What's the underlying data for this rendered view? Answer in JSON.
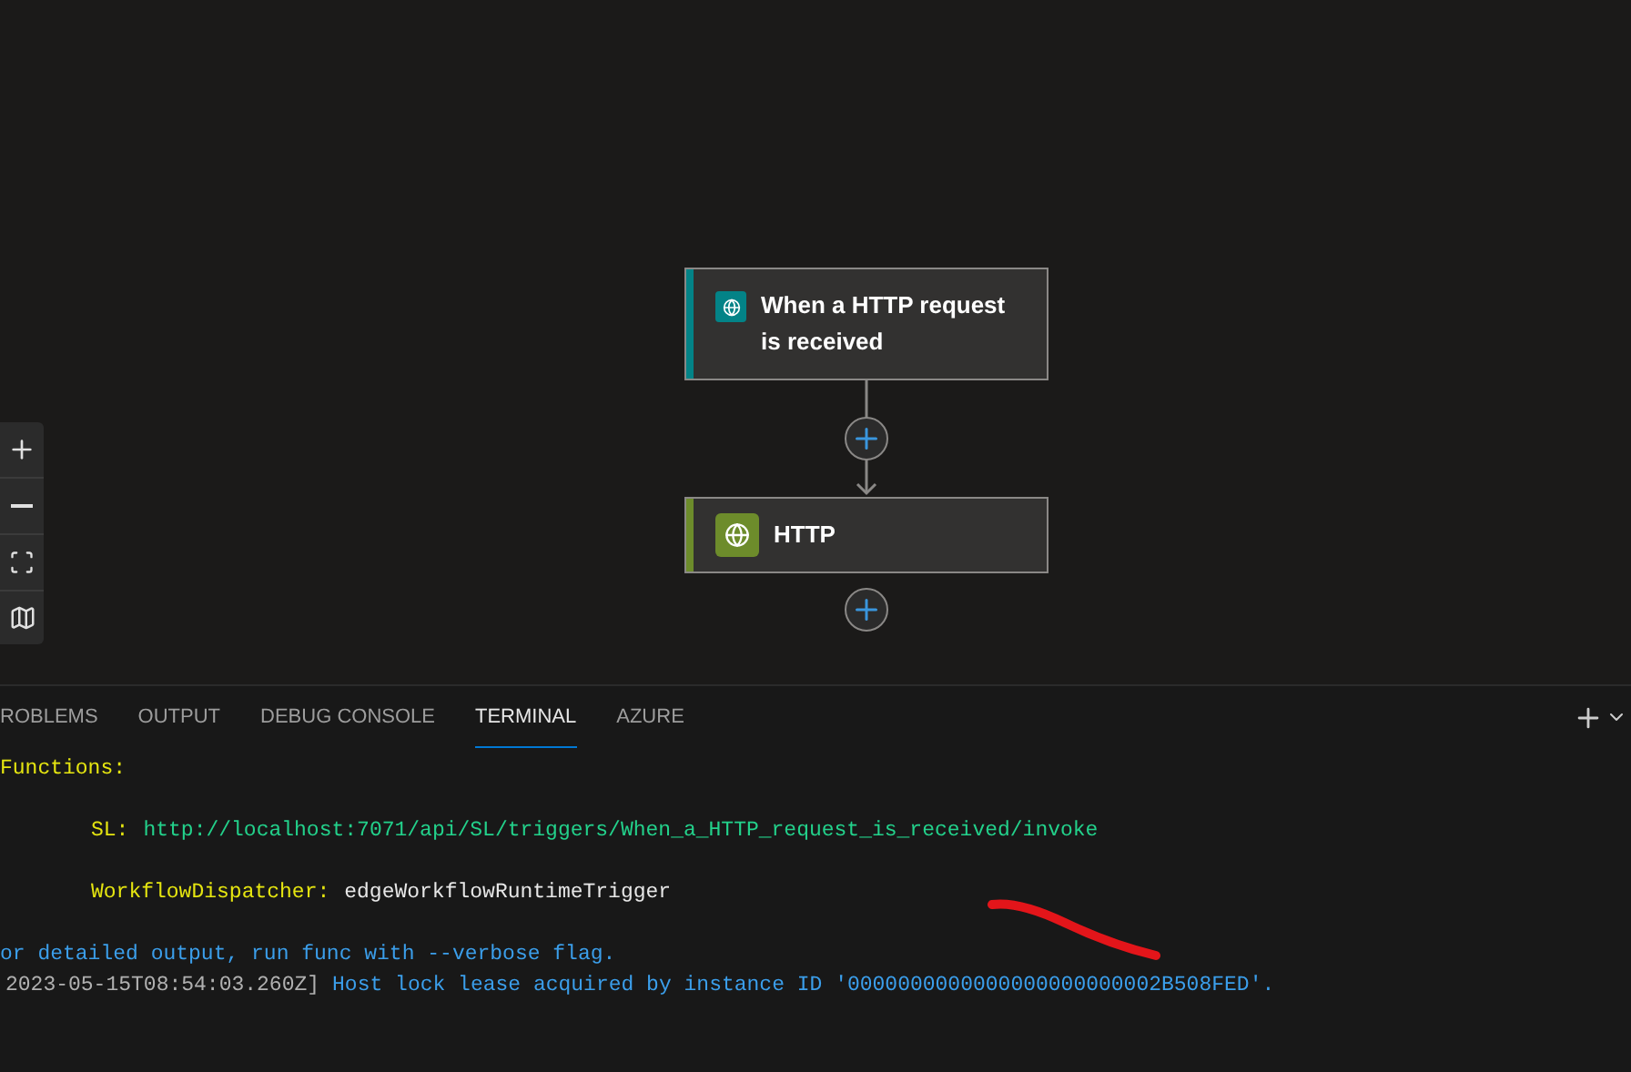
{
  "canvas": {
    "nodes": [
      {
        "title": "When a HTTP request is received",
        "kind": "trigger",
        "color": "#038387"
      },
      {
        "title": "HTTP",
        "kind": "action",
        "color": "#6d8c2b"
      }
    ]
  },
  "panel": {
    "tabs": [
      {
        "label": "ROBLEMS",
        "selected": false
      },
      {
        "label": "OUTPUT",
        "selected": false
      },
      {
        "label": "DEBUG CONSOLE",
        "selected": false
      },
      {
        "label": "TERMINAL",
        "selected": true
      },
      {
        "label": "AZURE",
        "selected": false
      }
    ]
  },
  "terminal": {
    "lines": [
      {
        "kind": "header",
        "text": "Functions:"
      },
      {
        "kind": "function",
        "name": "SL:",
        "value": "http://localhost:7071/api/SL/triggers/When_a_HTTP_request_is_received/invoke"
      },
      {
        "kind": "function",
        "name": "WorkflowDispatcher:",
        "value": "edgeWorkflowRuntimeTrigger"
      },
      {
        "kind": "info",
        "text": "or detailed output, run func with --verbose flag."
      },
      {
        "kind": "log",
        "time": "2023-05-15T08:54:03.260Z]",
        "text": "Host lock lease acquired by instance ID '0000000000000000000000002B508FED'."
      }
    ]
  }
}
